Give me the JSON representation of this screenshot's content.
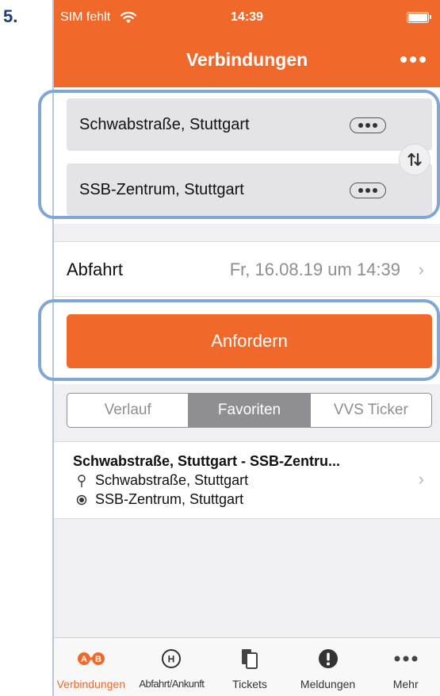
{
  "step_label": "5.",
  "status_bar": {
    "carrier": "SIM fehlt",
    "time": "14:39"
  },
  "nav": {
    "title": "Verbindungen"
  },
  "route": {
    "from": "Schwabstraße, Stuttgart",
    "to": "SSB-Zentrum, Stuttgart"
  },
  "departure": {
    "label": "Abfahrt",
    "value": "Fr, 16.08.19 um 14:39"
  },
  "request_button": "Anfordern",
  "segments": [
    {
      "label": "Verlauf",
      "active": false
    },
    {
      "label": "Favoriten",
      "active": true
    },
    {
      "label": "VVS Ticker",
      "active": false
    }
  ],
  "favorite": {
    "title": "Schwabstraße, Stuttgart - SSB-Zentru...",
    "from": "Schwabstraße, Stuttgart",
    "to": "SSB-Zentrum, Stuttgart"
  },
  "tabbar": {
    "items": [
      {
        "label": "Verbindungen",
        "icon": "a-b-route-icon",
        "active": true
      },
      {
        "label": "Abfahrt/Ankunft",
        "icon": "stop-h-icon",
        "active": false
      },
      {
        "label": "Tickets",
        "icon": "tickets-icon",
        "active": false
      },
      {
        "label": "Meldungen",
        "icon": "alert-icon",
        "active": false
      },
      {
        "label": "Mehr",
        "icon": "more-icon",
        "active": false
      }
    ]
  },
  "colors": {
    "accent": "#f0682a",
    "segment_gray": "#8e8e93"
  }
}
